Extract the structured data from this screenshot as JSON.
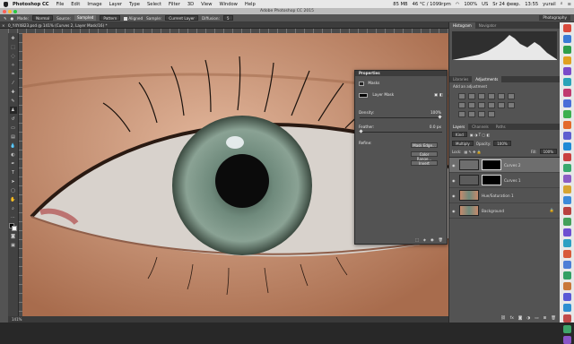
{
  "menubar": {
    "app_name": "Photoshop CC",
    "items": [
      "File",
      "Edit",
      "Image",
      "Layer",
      "Type",
      "Select",
      "Filter",
      "3D",
      "View",
      "Window",
      "Help"
    ],
    "status": [
      "85 MB",
      "46 °C / 1099rpm",
      "100%",
      "US",
      "Sr 24 февр.",
      "13:55",
      "yurail"
    ]
  },
  "window_title": "Adobe Photoshop CC 2015",
  "options": {
    "mode_label": "Mode:",
    "mode_value": "Normal",
    "source_label": "Source:",
    "sampled": "Sampled",
    "pattern": "Pattern",
    "aligned_label": "Aligned",
    "sample_label": "Sample:",
    "sample_value": "Current Layer",
    "diffusion_label": "Diffusion:",
    "diffusion_value": "5",
    "workspace": "Photography"
  },
  "document_tab": "0_Y4Y4823.psd @ 141% (Curves 2, Layer Mask/16) *",
  "status_bar": "141%",
  "properties": {
    "header": "Properties",
    "section": "Masks",
    "mask_type": "Layer Mask",
    "density_label": "Density:",
    "density_value": "100%",
    "feather_label": "Feather:",
    "feather_value": "0.0 px",
    "refine_label": "Refine:",
    "buttons": [
      "Mask Edge...",
      "Color Range...",
      "Invert"
    ]
  },
  "dock": {
    "top_tabs": [
      "Histogram",
      "Navigator"
    ],
    "mid_tabs": [
      "Libraries",
      "Adjustments"
    ],
    "adj_hint": "Add an adjustment",
    "layer_tabs": [
      "Layers",
      "Channels",
      "Paths"
    ],
    "kind_label": "Kind",
    "blend_mode": "Multiply",
    "opacity_label": "Opacity:",
    "opacity_value": "100%",
    "lock_label": "Lock:",
    "fill_label": "Fill:",
    "fill_value": "100%",
    "layers": [
      {
        "name": "Curves 2",
        "selected": true,
        "kind": "adjustment"
      },
      {
        "name": "Curves 1",
        "selected": false,
        "kind": "adjustment"
      },
      {
        "name": "Hue/Saturation 1",
        "selected": false,
        "kind": "photo"
      },
      {
        "name": "Background",
        "selected": false,
        "kind": "photo"
      }
    ]
  },
  "colors": {
    "iris": "#6f8a7c",
    "skin": "#c99275",
    "panel": "#535353",
    "menubar": "#e8e8e8"
  },
  "dock_icons": [
    "#d94a3c",
    "#3a7bd5",
    "#2e9e4a",
    "#e0a020",
    "#7b4bc9",
    "#2aa3b8",
    "#c03a6e",
    "#4a6dd8",
    "#3db04f",
    "#e36a2d",
    "#5f5fd0",
    "#1f8ad6",
    "#c94040",
    "#38a86d",
    "#8b5cc4",
    "#d6a431",
    "#3b89d9",
    "#b8413f",
    "#44a05a",
    "#6d4fd1",
    "#2c9fc3",
    "#d85a3a",
    "#4d7ed6",
    "#33a064",
    "#c9773a",
    "#5a5ad6",
    "#2d8fd1",
    "#c14a4a",
    "#3fa56a",
    "#8a55c7"
  ]
}
